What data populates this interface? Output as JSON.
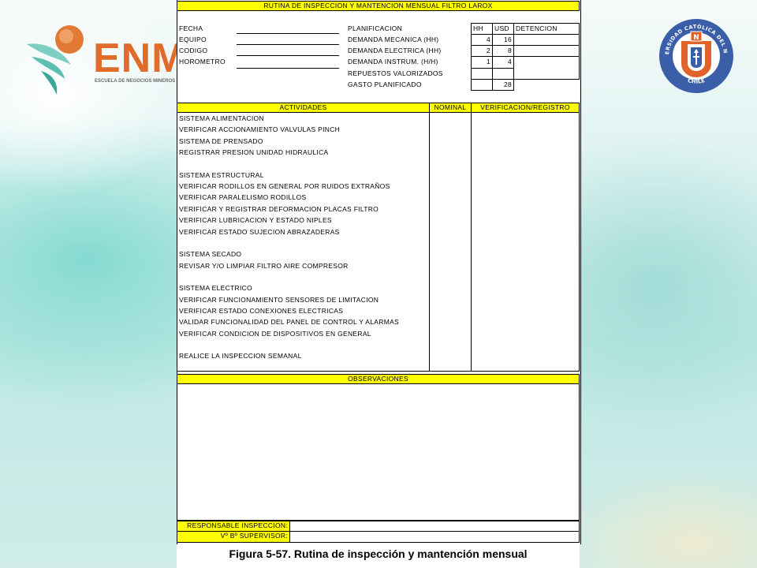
{
  "branding": {
    "enm_logo_text": "ENM",
    "enm_logo_subtitle": "ESCUELA DE NEGOCIOS MINEROS",
    "ucn_logo_text_top": "UNIVERSIDAD CATÓLICA DEL NORTE",
    "ucn_logo_text_bottom": "CHILE",
    "ucn_logo_letter": "U",
    "ucn_logo_badge": "N"
  },
  "form": {
    "title": "RUTINA DE INSPECCION Y MANTENCION MENSUAL FILTRO LAROX",
    "left_fields": [
      "FECHA",
      "EQUIPO",
      "CODIGO",
      "HOROMETRO"
    ],
    "planning": {
      "header": "PLANIFICACION",
      "columns": [
        "HH",
        "USD",
        "DETENCION"
      ],
      "rows": [
        {
          "label": "DEMANDA MECANICA (HH)",
          "hh": "4",
          "usd": "16"
        },
        {
          "label": "DEMANDA ELECTRICA (HH)",
          "hh": "2",
          "usd": "8"
        },
        {
          "label": "DEMANDA INSTRUM. (H/H)",
          "hh": "1",
          "usd": "4"
        },
        {
          "label": "REPUESTOS VALORIZADOS",
          "hh": "",
          "usd": ""
        },
        {
          "label": "GASTO PLANIFICADO",
          "hh": "",
          "usd": "28"
        }
      ]
    },
    "activities_header": "ACTIVIDADES",
    "nominal_header": "NOMINAL",
    "verification_header": "VERIFICACION/REGISTRO",
    "activities": [
      "SISTEMA ALIMENTACION",
      "VERIFICAR ACCIONAMIENTO VALVULAS PINCH",
      "SISTEMA DE PRENSADO",
      "REGISTRAR PRESION UNIDAD HIDRAULICA",
      "",
      "SISTEMA ESTRUCTURAL",
      "VERIFICAR RODILLOS EN GENERAL POR RUIDOS EXTRAÑOS",
      "VERIFICAR PARALELISMO RODILLOS",
      "VERIFICAR Y REGISTRAR DEFORMACION PLACAS FILTRO",
      "VERIFICAR LUBRICACION Y ESTADO NIPLES",
      "VERIFICAR ESTADO SUJECION ABRAZADERAS",
      "",
      "SISTEMA SECADO",
      "REVISAR Y/O LIMPIAR FILTRO AIRE COMPRESOR",
      "",
      "SISTEMA ELECTRICO",
      "VERIFICAR FUNCIONAMIENTO SENSORES DE LIMITACION",
      "VERIFICAR ESTADO CONEXIONES ELECTRICAS",
      "VALIDAR FUNCIONALIDAD DEL PANEL DE CONTROL Y ALARMAS",
      "VERIFICAR CONDICION DE DISPOSITIVOS EN GENERAL",
      "",
      "REALICE LA INSPECCION SEMANAL"
    ],
    "observations_header": "OBSERVACIONES",
    "responsible_label": "RESPONSABLE INSPECCION:",
    "supervisor_label": "Vº Bº SUPERVISOR:"
  },
  "caption": "Figura 5-57. Rutina de inspección y mantención mensual",
  "colors": {
    "header_yellow": "#ffff00",
    "enm_orange": "#e06b2a",
    "ucn_blue": "#3a5fa8",
    "ucn_orange": "#e2632a"
  }
}
